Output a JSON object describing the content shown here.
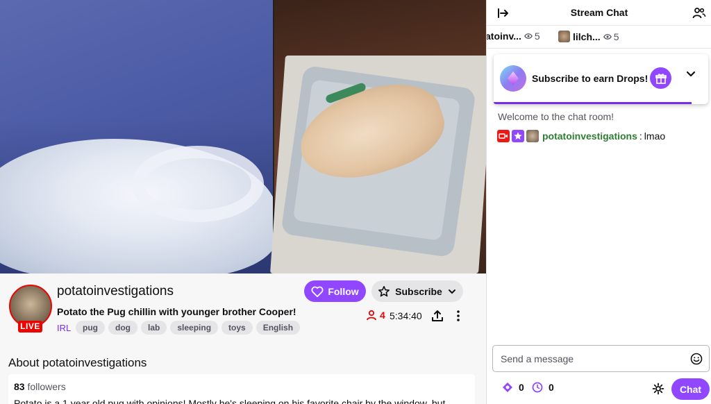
{
  "video": {
    "alt": ""
  },
  "channel": {
    "name": "potatoinvestigations",
    "live_badge": "LIVE",
    "title": "Potato the Pug chillin with younger brother Cooper!",
    "category": "IRL",
    "tags": [
      "pug",
      "dog",
      "lab",
      "sleeping",
      "toys",
      "English"
    ],
    "follow_label": "Follow",
    "subscribe_label": "Subscribe",
    "viewer_count": "4",
    "uptime": "5:34:40"
  },
  "about": {
    "title": "About potatoinvestigations",
    "followers_count": "83",
    "followers_label": "followers",
    "description": "Potato is a 1 year old pug with opinions! Mostly he's sleeping on his favorite chair by the window, but"
  },
  "chat": {
    "title": "Stream Chat",
    "viewer_bar": [
      {
        "name": "atoinv...",
        "count": "5"
      },
      {
        "name": "lilch...",
        "count": "5"
      }
    ],
    "drops_text": "Subscribe to earn Drops!",
    "welcome": "Welcome to the chat room!",
    "messages": [
      {
        "user": "potatoinvestigations",
        "separator": ":",
        "text": "lmao"
      }
    ],
    "input_placeholder": "Send a message",
    "points": "0",
    "watch_streak": "0",
    "send_label": "Chat"
  },
  "colors": {
    "accent": "#9147ff",
    "live": "#eb0400",
    "chat_username": "#2e7d32"
  }
}
